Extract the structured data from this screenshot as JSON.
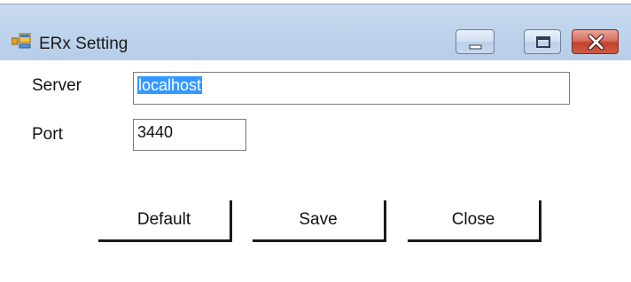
{
  "window": {
    "title": "ERx Setting"
  },
  "form": {
    "server": {
      "label": "Server",
      "value": "localhost"
    },
    "port": {
      "label": "Port",
      "value": "3440"
    }
  },
  "buttons": {
    "default_label": "Default",
    "save_label": "Save",
    "close_label": "Close"
  },
  "colors": {
    "titlebar": "#bfd4ec",
    "selection": "#3399ff",
    "close_button": "#c3422e"
  },
  "icons": {
    "app": "window-app-icon",
    "minimize": "minimize-icon",
    "maximize": "maximize-icon",
    "close": "close-icon"
  }
}
